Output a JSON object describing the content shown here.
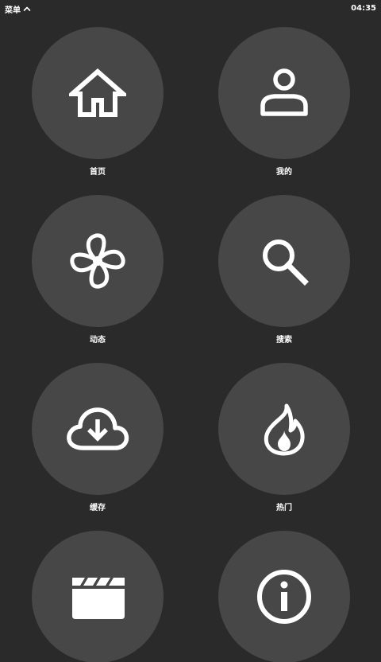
{
  "status_bar": {
    "menu_label": "菜单",
    "time": "04:35"
  },
  "menu": {
    "items": [
      {
        "label": "首页",
        "icon": "home-icon"
      },
      {
        "label": "我的",
        "icon": "person-icon"
      },
      {
        "label": "动态",
        "icon": "fan-icon"
      },
      {
        "label": "搜索",
        "icon": "search-icon"
      },
      {
        "label": "缓存",
        "icon": "cloud-download-icon"
      },
      {
        "label": "热门",
        "icon": "fire-icon"
      },
      {
        "label": "",
        "icon": "clapperboard-icon"
      },
      {
        "label": "",
        "icon": "info-icon"
      }
    ]
  },
  "colors": {
    "background": "#2a2a2a",
    "tile": "#474747",
    "foreground": "#ffffff"
  }
}
